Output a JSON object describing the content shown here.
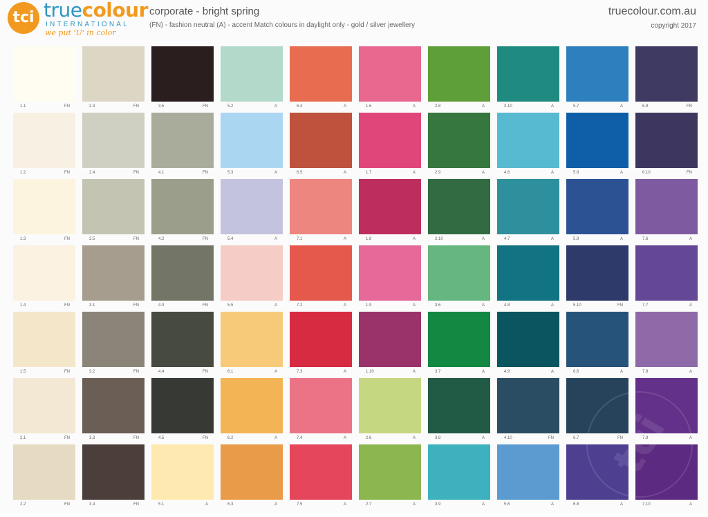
{
  "header": {
    "logo": {
      "mark": "tci",
      "name_part_a": "true",
      "name_part_b": "colour",
      "sub": "INTERNATIONAL",
      "tagline": "we put 'U' in color"
    },
    "title": "corporate - bright spring",
    "subtitle": "(FN) - fashion neutral    (A) - accent    Match colours in daylight only - gold / silver jewellery",
    "site": "truecolour.com.au",
    "copyright": "copyright 2017"
  },
  "swatches": [
    {
      "code": "1.1",
      "type": "FN",
      "color": "#fffdf2"
    },
    {
      "code": "2.3",
      "type": "FN",
      "color": "#dcd6c5"
    },
    {
      "code": "3.5",
      "type": "FN",
      "color": "#2b1e1e"
    },
    {
      "code": "5.2",
      "type": "A",
      "color": "#b2d9ca"
    },
    {
      "code": "6.4",
      "type": "A",
      "color": "#e86d50"
    },
    {
      "code": "1.6",
      "type": "A",
      "color": "#e9688f"
    },
    {
      "code": "2.8",
      "type": "A",
      "color": "#5f9f3a"
    },
    {
      "code": "3.10",
      "type": "A",
      "color": "#1f8a80"
    },
    {
      "code": "5.7",
      "type": "A",
      "color": "#2e7fbd"
    },
    {
      "code": "6.9",
      "type": "FN",
      "color": "#3e3a61"
    },
    {
      "code": "1.2",
      "type": "FN",
      "color": "#f8f0e2"
    },
    {
      "code": "2.4",
      "type": "FN",
      "color": "#cfd0c2"
    },
    {
      "code": "4.1",
      "type": "FN",
      "color": "#a9ac9b"
    },
    {
      "code": "5.3",
      "type": "A",
      "color": "#abd6f2"
    },
    {
      "code": "6.5",
      "type": "A",
      "color": "#be523d"
    },
    {
      "code": "1.7",
      "type": "A",
      "color": "#e0467a"
    },
    {
      "code": "2.9",
      "type": "A",
      "color": "#36763f"
    },
    {
      "code": "4.6",
      "type": "A",
      "color": "#58bad0"
    },
    {
      "code": "5.8",
      "type": "A",
      "color": "#0e5fa8"
    },
    {
      "code": "6.10",
      "type": "FN",
      "color": "#3d3760"
    },
    {
      "code": "1.3",
      "type": "FN",
      "color": "#fdf4e0"
    },
    {
      "code": "2.5",
      "type": "FN",
      "color": "#c4c4b3"
    },
    {
      "code": "4.2",
      "type": "FN",
      "color": "#9c9e8c"
    },
    {
      "code": "5.4",
      "type": "A",
      "color": "#c3c3df"
    },
    {
      "code": "7.1",
      "type": "A",
      "color": "#ec867e"
    },
    {
      "code": "1.8",
      "type": "A",
      "color": "#bd2e5f"
    },
    {
      "code": "2.10",
      "type": "A",
      "color": "#326b42"
    },
    {
      "code": "4.7",
      "type": "A",
      "color": "#2e8f9d"
    },
    {
      "code": "5.9",
      "type": "A",
      "color": "#2c5294"
    },
    {
      "code": "7.6",
      "type": "A",
      "color": "#7e5ba1"
    },
    {
      "code": "1.4",
      "type": "FN",
      "color": "#fbf2e2"
    },
    {
      "code": "3.1",
      "type": "FN",
      "color": "#a79d8f"
    },
    {
      "code": "4.3",
      "type": "FN",
      "color": "#737667"
    },
    {
      "code": "5.5",
      "type": "A",
      "color": "#f5cdc6"
    },
    {
      "code": "7.2",
      "type": "A",
      "color": "#e5594c"
    },
    {
      "code": "1.9",
      "type": "A",
      "color": "#e56a9a"
    },
    {
      "code": "3.6",
      "type": "A",
      "color": "#66b67f"
    },
    {
      "code": "4.8",
      "type": "A",
      "color": "#127383"
    },
    {
      "code": "5.10",
      "type": "FN",
      "color": "#2e3a6a"
    },
    {
      "code": "7.7",
      "type": "A",
      "color": "#644796"
    },
    {
      "code": "1.5",
      "type": "FN",
      "color": "#f4e6c9"
    },
    {
      "code": "3.2",
      "type": "FN",
      "color": "#8a8578"
    },
    {
      "code": "4.4",
      "type": "FN",
      "color": "#474a41"
    },
    {
      "code": "6.1",
      "type": "A",
      "color": "#f6ca78"
    },
    {
      "code": "7.3",
      "type": "A",
      "color": "#d72b41"
    },
    {
      "code": "1.10",
      "type": "A",
      "color": "#9a336a"
    },
    {
      "code": "3.7",
      "type": "A",
      "color": "#128843"
    },
    {
      "code": "4.9",
      "type": "A",
      "color": "#0b5560"
    },
    {
      "code": "6.6",
      "type": "A",
      "color": "#26537a"
    },
    {
      "code": "7.8",
      "type": "A",
      "color": "#8e6aa9"
    },
    {
      "code": "2.1",
      "type": "FN",
      "color": "#f3e8d3"
    },
    {
      "code": "3.3",
      "type": "FN",
      "color": "#6b5e55"
    },
    {
      "code": "4.5",
      "type": "FN",
      "color": "#373935"
    },
    {
      "code": "6.2",
      "type": "A",
      "color": "#f2b454"
    },
    {
      "code": "7.4",
      "type": "A",
      "color": "#ea7486"
    },
    {
      "code": "2.6",
      "type": "A",
      "color": "#c5d781"
    },
    {
      "code": "3.8",
      "type": "A",
      "color": "#225b45"
    },
    {
      "code": "4.10",
      "type": "FN",
      "color": "#2b4d63"
    },
    {
      "code": "6.7",
      "type": "FN",
      "color": "#27435c"
    },
    {
      "code": "7.9",
      "type": "A",
      "color": "#633189"
    },
    {
      "code": "2.2",
      "type": "FN",
      "color": "#e6dac3"
    },
    {
      "code": "3.4",
      "type": "FN",
      "color": "#4c3f3b"
    },
    {
      "code": "5.1",
      "type": "A",
      "color": "#feeab0"
    },
    {
      "code": "6.3",
      "type": "A",
      "color": "#ea9b49"
    },
    {
      "code": "7.5",
      "type": "A",
      "color": "#e5465b"
    },
    {
      "code": "2.7",
      "type": "A",
      "color": "#8cb64f"
    },
    {
      "code": "3.9",
      "type": "A",
      "color": "#3db1bd"
    },
    {
      "code": "5.6",
      "type": "A",
      "color": "#5b9bcf"
    },
    {
      "code": "6.8",
      "type": "A",
      "color": "#4e3f91"
    },
    {
      "code": "7.10",
      "type": "A",
      "color": "#5c2a81"
    }
  ],
  "watermark": "tci"
}
